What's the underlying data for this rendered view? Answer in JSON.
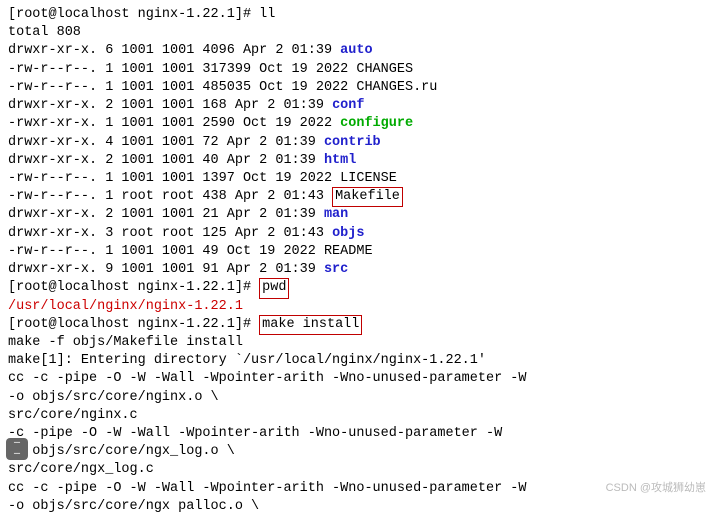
{
  "prompt1": "[root@localhost nginx-1.22.1]# ll",
  "total": "total 808",
  "files": [
    {
      "perm": "drwxr-xr-x.",
      "n": "6",
      "u": "1001",
      "g": "1001",
      "size": "4096",
      "m": "Apr",
      "d": "2",
      "t": "01:39",
      "name": "auto",
      "cls": "dir-blue",
      "box": false
    },
    {
      "perm": "-rw-r--r--.",
      "n": "1",
      "u": "1001",
      "g": "1001",
      "size": "317399",
      "m": "Oct",
      "d": "19",
      "t": "2022",
      "name": "CHANGES",
      "cls": "",
      "box": false
    },
    {
      "perm": "-rw-r--r--.",
      "n": "1",
      "u": "1001",
      "g": "1001",
      "size": "485035",
      "m": "Oct",
      "d": "19",
      "t": "2022",
      "name": "CHANGES.ru",
      "cls": "",
      "box": false
    },
    {
      "perm": "drwxr-xr-x.",
      "n": "2",
      "u": "1001",
      "g": "1001",
      "size": "168",
      "m": "Apr",
      "d": "2",
      "t": "01:39",
      "name": "conf",
      "cls": "dir-blue",
      "box": false
    },
    {
      "perm": "-rwxr-xr-x.",
      "n": "1",
      "u": "1001",
      "g": "1001",
      "size": "2590",
      "m": "Oct",
      "d": "19",
      "t": "2022",
      "name": "configure",
      "cls": "file-green",
      "box": false
    },
    {
      "perm": "drwxr-xr-x.",
      "n": "4",
      "u": "1001",
      "g": "1001",
      "size": "72",
      "m": "Apr",
      "d": "2",
      "t": "01:39",
      "name": "contrib",
      "cls": "dir-blue",
      "box": false
    },
    {
      "perm": "drwxr-xr-x.",
      "n": "2",
      "u": "1001",
      "g": "1001",
      "size": "40",
      "m": "Apr",
      "d": "2",
      "t": "01:39",
      "name": "html",
      "cls": "dir-blue",
      "box": false
    },
    {
      "perm": "-rw-r--r--.",
      "n": "1",
      "u": "1001",
      "g": "1001",
      "size": "1397",
      "m": "Oct",
      "d": "19",
      "t": "2022",
      "name": "LICENSE",
      "cls": "",
      "box": false
    },
    {
      "perm": "-rw-r--r--.",
      "n": "1",
      "u": "root",
      "g": "root",
      "size": "438",
      "m": "Apr",
      "d": "2",
      "t": "01:43",
      "name": "Makefile",
      "cls": "",
      "box": true
    },
    {
      "perm": "drwxr-xr-x.",
      "n": "2",
      "u": "1001",
      "g": "1001",
      "size": "21",
      "m": "Apr",
      "d": "2",
      "t": "01:39",
      "name": "man",
      "cls": "dir-blue",
      "box": false
    },
    {
      "perm": "drwxr-xr-x.",
      "n": "3",
      "u": "root",
      "g": "root",
      "size": "125",
      "m": "Apr",
      "d": "2",
      "t": "01:43",
      "name": "objs",
      "cls": "dir-blue",
      "box": false
    },
    {
      "perm": "-rw-r--r--.",
      "n": "1",
      "u": "1001",
      "g": "1001",
      "size": "49",
      "m": "Oct",
      "d": "19",
      "t": "2022",
      "name": "README",
      "cls": "",
      "box": false
    },
    {
      "perm": "drwxr-xr-x.",
      "n": "9",
      "u": "1001",
      "g": "1001",
      "size": "91",
      "m": "Apr",
      "d": "2",
      "t": "01:39",
      "name": "src",
      "cls": "dir-blue",
      "box": false
    }
  ],
  "prompt2_pre": "[root@localhost nginx-1.22.1]# ",
  "prompt2_cmd": "pwd",
  "pwd_out": "/usr/local/nginx/nginx-1.22.1",
  "prompt3_pre": "[root@localhost nginx-1.22.1]# ",
  "prompt3_cmd": "make install",
  "make_lines": [
    "make -f objs/Makefile install",
    "make[1]: Entering directory `/usr/local/nginx/nginx-1.22.1'",
    "cc -c -pipe  -O -W -Wall -Wpointer-arith -Wno-unused-parameter -W",
    "        -o objs/src/core/nginx.o \\",
    "        src/core/nginx.c",
    "   -c -pipe  -O -W -Wall -Wpointer-arith -Wno-unused-parameter -W",
    "        -o objs/src/core/ngx_log.o \\",
    "        src/core/ngx_log.c",
    "cc -c -pipe  -O -W -Wall -Wpointer-arith -Wno-unused-parameter -W",
    "        -o objs/src/core/ngx palloc.o \\"
  ],
  "watermark": "CSDN @攻城狮幼崽"
}
